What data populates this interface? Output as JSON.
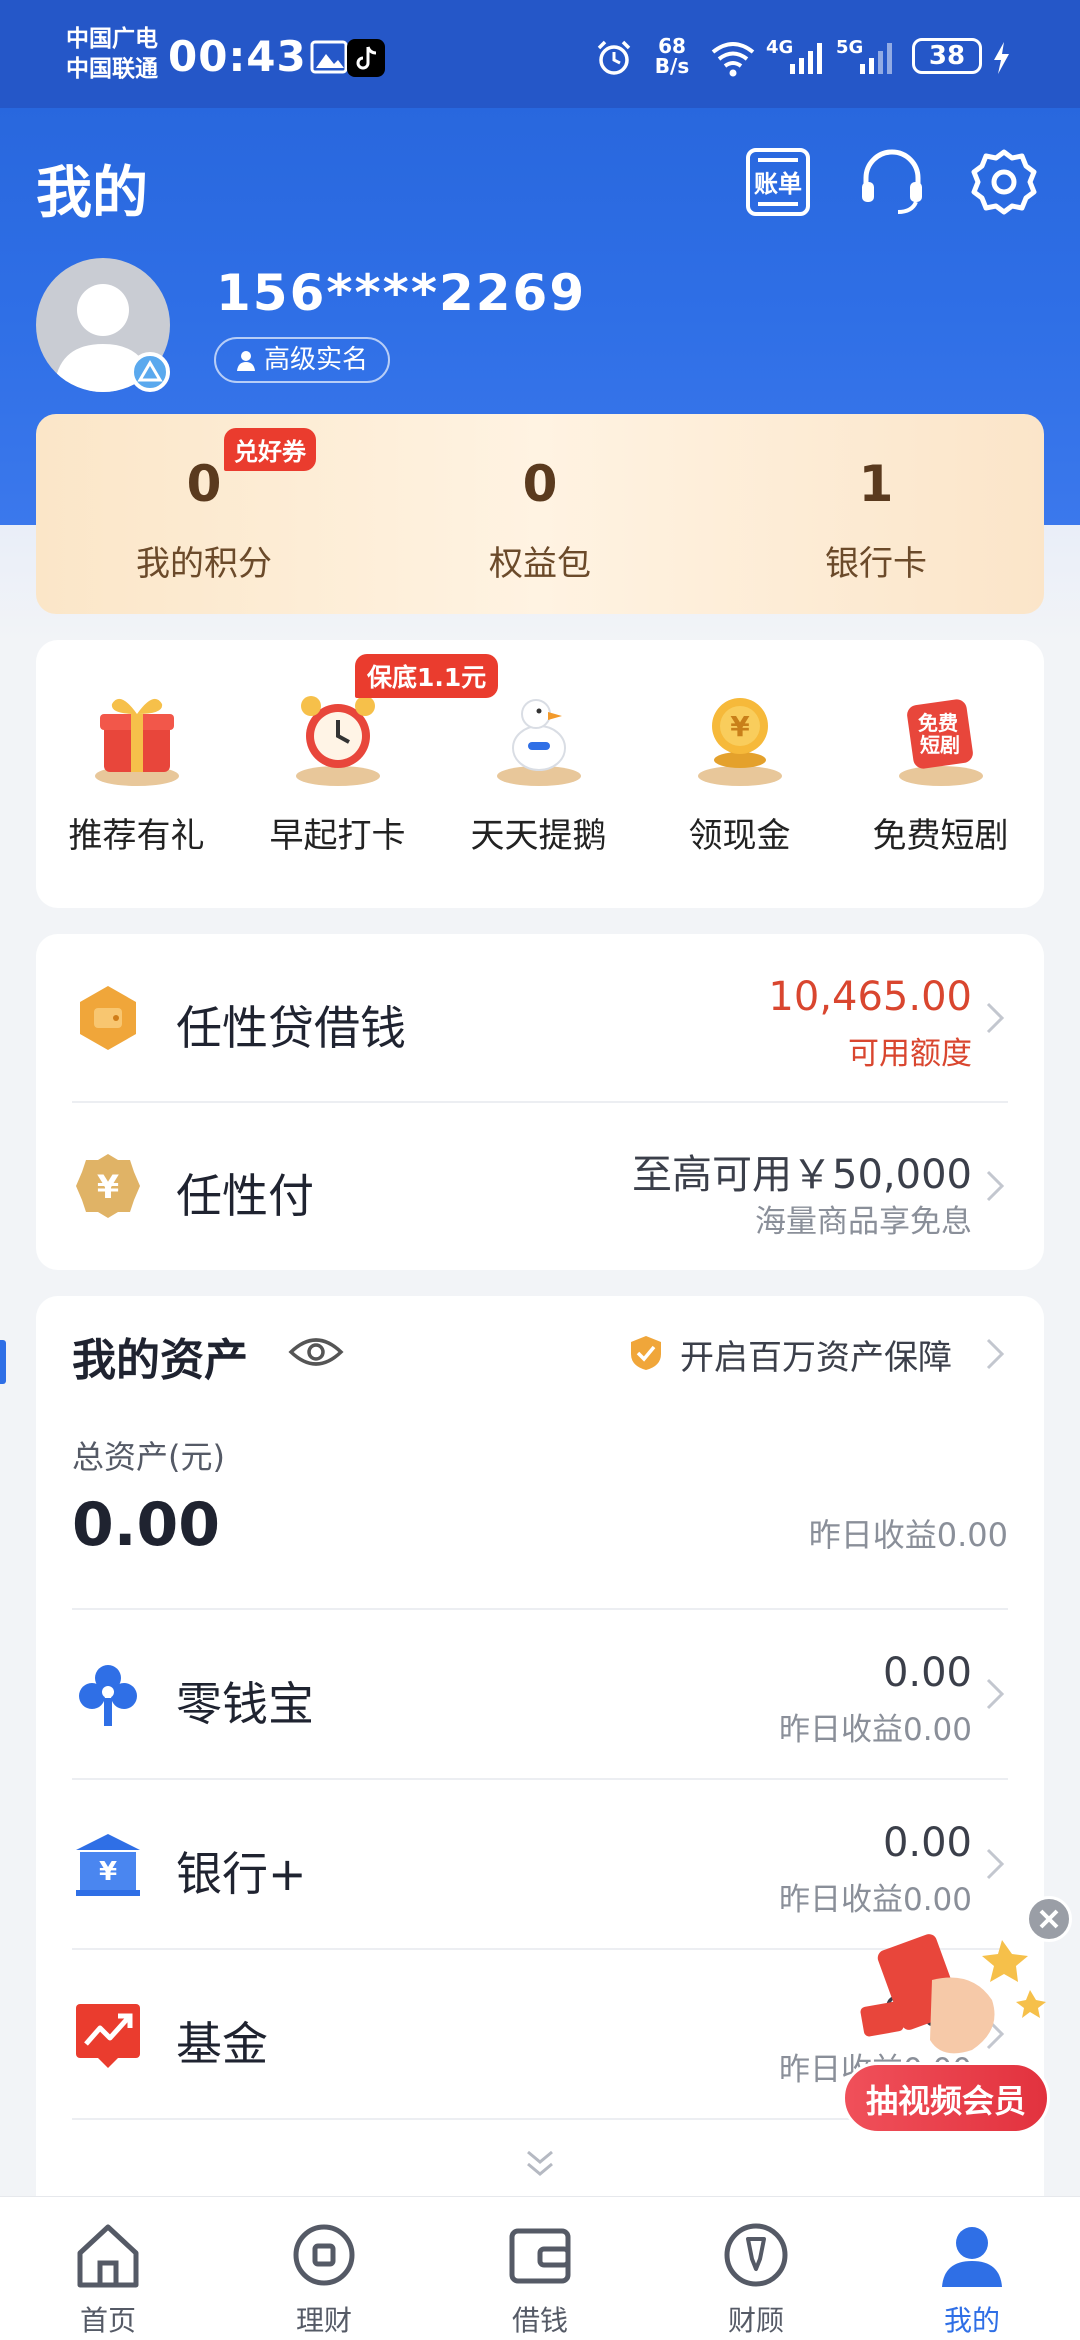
{
  "status_bar": {
    "carrier1": "中国广电",
    "carrier2": "中国联通",
    "time": "00:43",
    "net_speed_value": "68",
    "net_speed_unit": "B/s",
    "net_4g": "4G",
    "net_5g": "5G",
    "battery": "38"
  },
  "header": {
    "title": "我的",
    "bill_label": "账单",
    "icons": [
      "bill-icon",
      "headset-icon",
      "gear-icon"
    ]
  },
  "profile": {
    "phone": "156****2269",
    "verify_label": "高级实名"
  },
  "points": [
    {
      "value": "0",
      "label": "我的积分",
      "tag": "兑好券"
    },
    {
      "value": "0",
      "label": "权益包"
    },
    {
      "value": "1",
      "label": "银行卡"
    }
  ],
  "features": {
    "items": [
      {
        "label": "推荐有礼",
        "icon": "gift-icon"
      },
      {
        "label": "早起打卡",
        "icon": "alarm-clock-icon"
      },
      {
        "label": "天天提鹅",
        "icon": "goose-icon"
      },
      {
        "label": "领现金",
        "icon": "coin-icon"
      },
      {
        "label": "免费短剧",
        "icon": "short-drama-icon"
      }
    ],
    "badge": "保底1.1元",
    "drama_icon_text": "免费短剧"
  },
  "loans": [
    {
      "title": "任性贷借钱",
      "right_top": "10,465.00",
      "right_bottom": "可用额度",
      "icon": "wallet-icon"
    },
    {
      "title": "任性付",
      "right_top": "至高可用￥50,000",
      "right_bottom": "海量商品享免息",
      "icon": "yuan-badge-icon"
    }
  ],
  "assets": {
    "title": "我的资产",
    "protect_label": "开启百万资产保障",
    "total_label": "总资产(元)",
    "total_value": "0.00",
    "yesterday_label": "昨日收益0.00",
    "items": [
      {
        "title": "零钱宝",
        "value": "0.00",
        "sub": "昨日收益0.00",
        "icon": "clover-icon"
      },
      {
        "title": "银行+",
        "value": "0.00",
        "sub": "昨日收益0.00",
        "icon": "bank-icon"
      },
      {
        "title": "基金",
        "value": "0.00",
        "sub": "昨日收益0.00",
        "icon": "fund-trend-icon"
      }
    ]
  },
  "promo": {
    "label": "抽视频会员"
  },
  "tabbar": [
    {
      "label": "首页",
      "icon": "home-icon"
    },
    {
      "label": "理财",
      "icon": "finance-icon"
    },
    {
      "label": "借钱",
      "icon": "wallet-tab-icon"
    },
    {
      "label": "财顾",
      "icon": "advisor-icon"
    },
    {
      "label": "我的",
      "icon": "profile-icon",
      "active": true
    }
  ],
  "colors": {
    "primary": "#2f6fe6",
    "accent_red": "#ea3c2e",
    "loan_amount": "#d9462f",
    "gold": "#f0a63a"
  }
}
